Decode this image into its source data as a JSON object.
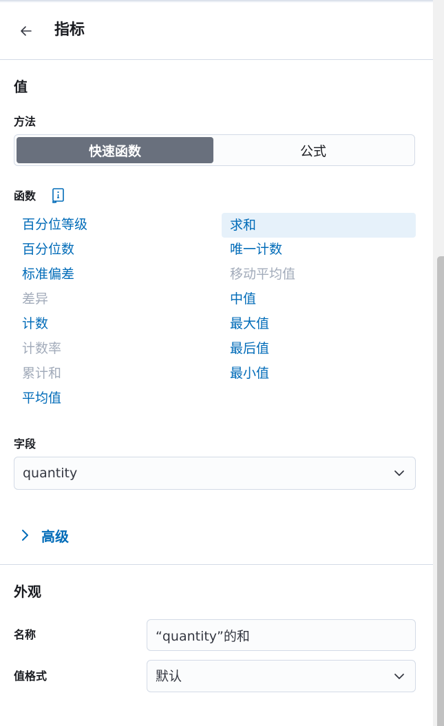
{
  "header": {
    "title": "指标",
    "back_icon": "arrow-left-icon"
  },
  "value_section": {
    "title": "值",
    "method": {
      "label": "方法",
      "options": [
        "快速函数",
        "公式"
      ],
      "selected": "快速函数"
    },
    "functions": {
      "label": "函数",
      "docs_icon": "documentation-icon",
      "left_column": [
        {
          "label": "百分位等级",
          "enabled": true
        },
        {
          "label": "百分位数",
          "enabled": true
        },
        {
          "label": "标准偏差",
          "enabled": true
        },
        {
          "label": "差异",
          "enabled": false
        },
        {
          "label": "计数",
          "enabled": true
        },
        {
          "label": "计数率",
          "enabled": false
        },
        {
          "label": "累计和",
          "enabled": false
        },
        {
          "label": "平均值",
          "enabled": true
        }
      ],
      "right_column": [
        {
          "label": "求和",
          "enabled": true,
          "selected": true
        },
        {
          "label": "唯一计数",
          "enabled": true
        },
        {
          "label": "移动平均值",
          "enabled": false
        },
        {
          "label": "中值",
          "enabled": true
        },
        {
          "label": "最大值",
          "enabled": true
        },
        {
          "label": "最后值",
          "enabled": true
        },
        {
          "label": "最小值",
          "enabled": true
        }
      ]
    },
    "field": {
      "label": "字段",
      "value": "quantity"
    },
    "advanced": {
      "label": "高级",
      "icon": "chevron-right-icon"
    }
  },
  "appearance_section": {
    "title": "外观",
    "name": {
      "label": "名称",
      "value": "“quantity”的和"
    },
    "value_format": {
      "label": "值格式",
      "value": "默认"
    }
  },
  "colors": {
    "accent": "#006bb8",
    "disabled": "#a2abba",
    "selected_bg": "#e6f1fa",
    "active_segment": "#69707d"
  }
}
